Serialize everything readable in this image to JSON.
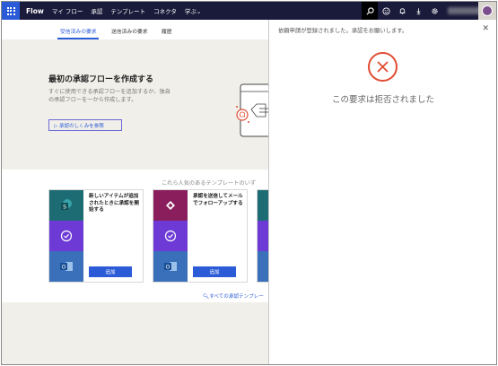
{
  "nav": {
    "brand": "Flow",
    "items": [
      "マイ フロー",
      "承認",
      "テンプレート",
      "コネクタ",
      "学ぶ"
    ]
  },
  "tabs": [
    "受信済みの要求",
    "送信済みの要求",
    "履歴"
  ],
  "hero": {
    "title": "最初の承認フローを作成する",
    "description": "すぐに使用できる承認フローを追加するか、独自の承認フローを一から作成します。",
    "link": "▷ 承認のしくみを参照"
  },
  "templates": {
    "heading": "これら人気のあるテンプレートのいず",
    "cards": [
      {
        "title": "新しいアイテムが追加されたときに承認を開始する",
        "button": "追加"
      },
      {
        "title": "承認を送信してメールでフォローアップする",
        "button": "追加"
      }
    ],
    "see_all": "すべての承認テンプレー"
  },
  "panel": {
    "message": "依頼申請が登録されました。承認をお願いします。",
    "status": "この要求は拒否されました"
  },
  "colors": {
    "nav_bg": "#1a1a3a",
    "accent": "#2b5bd7",
    "reject": "#e04b32",
    "sharepoint": "#1d6c74",
    "approvals": "#6d3ad6",
    "outlook": "#3a6fba",
    "flow_icon": "#8a1e5c"
  },
  "icons": [
    "waffle-icon",
    "search-icon",
    "smiley-icon",
    "bell-icon",
    "download-icon",
    "gear-icon",
    "close-icon",
    "reject-x-icon",
    "sharepoint-icon",
    "approvals-icon",
    "outlook-icon"
  ]
}
